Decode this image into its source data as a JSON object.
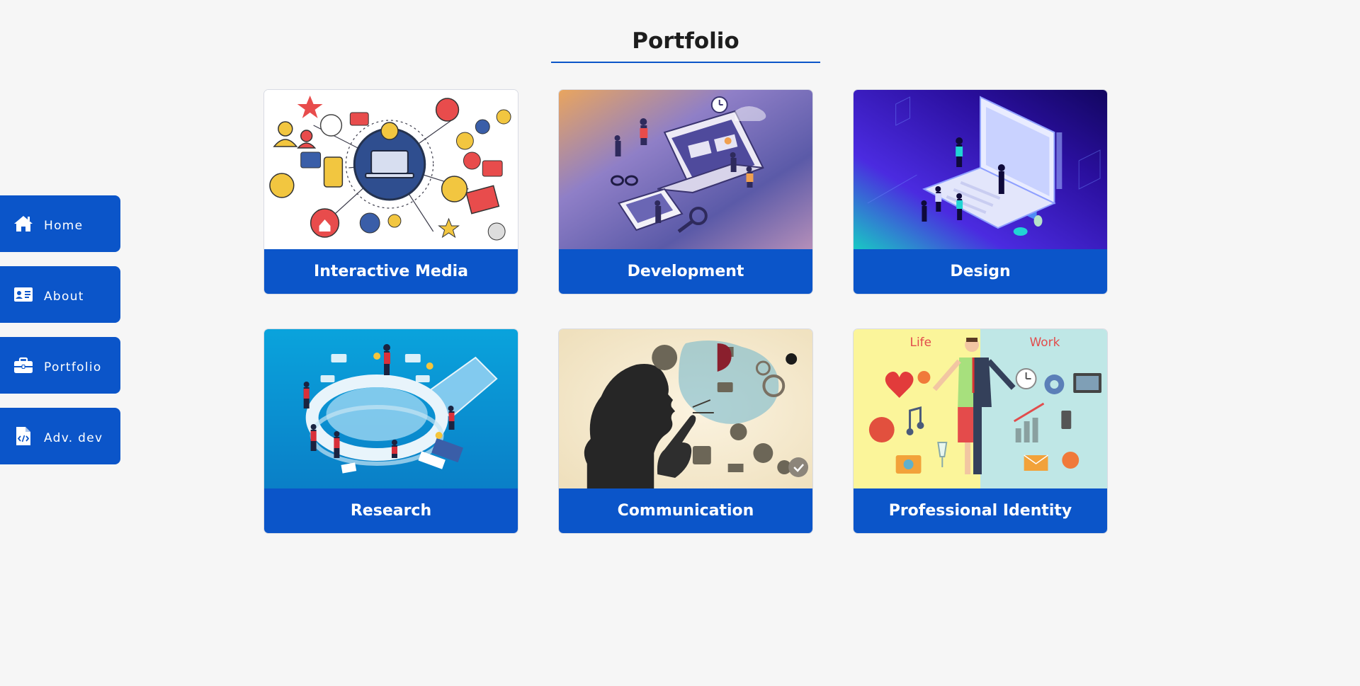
{
  "nav": {
    "items": [
      {
        "label": "Home",
        "icon": "home-icon"
      },
      {
        "label": "About",
        "icon": "id-card-icon"
      },
      {
        "label": "Portfolio",
        "icon": "briefcase-icon"
      },
      {
        "label": "Adv. dev",
        "icon": "code-file-icon"
      }
    ]
  },
  "header": {
    "title": "Portfolio"
  },
  "cards": [
    {
      "label": "Interactive Media",
      "image": "interactive-media-illustration"
    },
    {
      "label": "Development",
      "image": "development-illustration"
    },
    {
      "label": "Design",
      "image": "design-illustration"
    },
    {
      "label": "Research",
      "image": "research-illustration"
    },
    {
      "label": "Communication",
      "image": "communication-illustration"
    },
    {
      "label": "Professional Identity",
      "image": "professional-identity-illustration",
      "image_text": {
        "left": "Life",
        "right": "Work"
      }
    }
  ],
  "colors": {
    "accent": "#0b55c9",
    "background": "#f6f6f6",
    "title": "#1d1d1d"
  }
}
